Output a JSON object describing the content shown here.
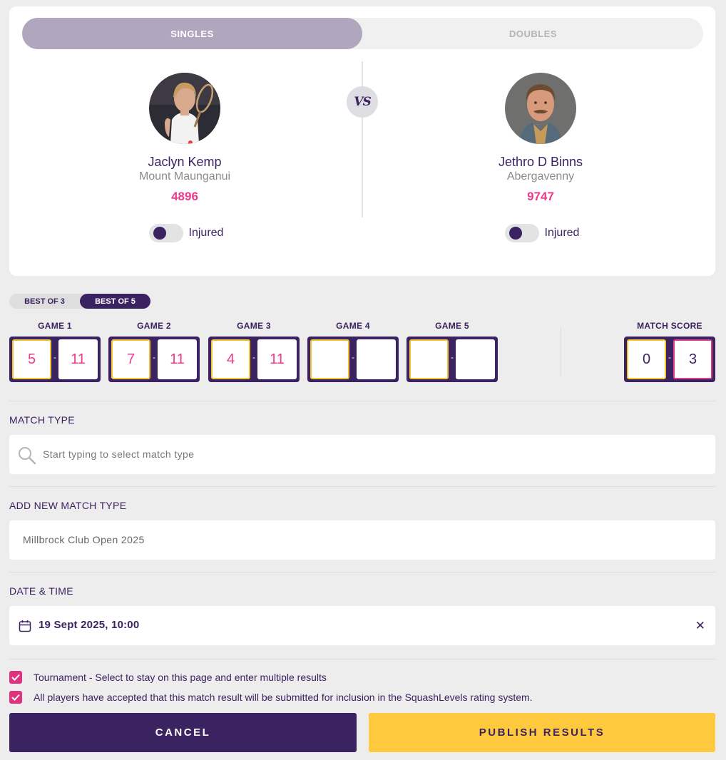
{
  "mode_toggle": {
    "singles": "SINGLES",
    "doubles": "DOUBLES",
    "selected": "SINGLES"
  },
  "vs_label": "VS",
  "players": [
    {
      "name": "Jaclyn Kemp",
      "club": "Mount Maunganui",
      "rating": "4896",
      "injured_label": "Injured"
    },
    {
      "name": "Jethro D Binns",
      "club": "Abergavenny",
      "rating": "9747",
      "injured_label": "Injured"
    }
  ],
  "best_of": {
    "options": [
      "BEST OF 3",
      "BEST OF 5"
    ],
    "selected": "BEST OF 5"
  },
  "games": [
    {
      "label": "GAME 1",
      "a": "5",
      "b": "11"
    },
    {
      "label": "GAME 2",
      "a": "7",
      "b": "11"
    },
    {
      "label": "GAME 3",
      "a": "4",
      "b": "11"
    },
    {
      "label": "GAME 4",
      "a": "",
      "b": ""
    },
    {
      "label": "GAME 5",
      "a": "",
      "b": ""
    }
  ],
  "score_separator": "-",
  "match_score": {
    "label": "MATCH SCORE",
    "a": "0",
    "b": "3"
  },
  "match_type": {
    "label": "MATCH TYPE",
    "placeholder": "Start typing to select match type",
    "icon": "search-icon"
  },
  "new_match_type": {
    "label": "ADD NEW MATCH TYPE",
    "value": "Millbrock Club Open 2025"
  },
  "date_time": {
    "label": "DATE & TIME",
    "value": "19 Sept 2025, 10:00",
    "icon": "calendar-icon",
    "clear": "✕"
  },
  "checks": [
    {
      "label": "Tournament - Select to stay on this page and enter multiple results",
      "checked": true
    },
    {
      "label": "All players have accepted that this match result will be submitted for inclusion in the SquashLevels rating system.",
      "checked": true
    }
  ],
  "buttons": {
    "cancel": "CANCEL",
    "publish": "PUBLISH RESULTS"
  },
  "colors": {
    "primary": "#3b2260",
    "accent_pink": "#ee3a8c",
    "accent_yellow": "#ffc93d",
    "background": "#ededed"
  }
}
